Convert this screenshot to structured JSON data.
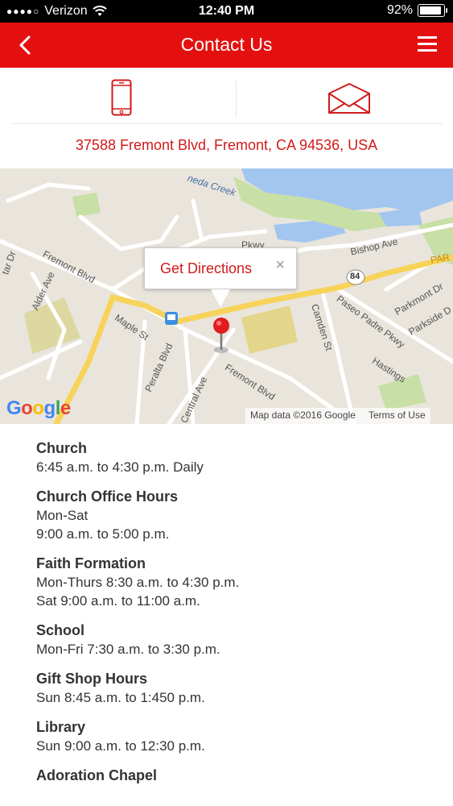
{
  "status_bar": {
    "carrier": "Verizon",
    "time": "12:40 PM",
    "battery": "92%",
    "battery_level": 0.92
  },
  "header": {
    "title": "Contact Us",
    "back_icon": "chevron-left-icon",
    "menu_icon": "hamburger-menu-icon"
  },
  "contact": {
    "phone_icon": "phone-icon",
    "email_icon": "envelope-icon",
    "address": "37588 Fremont Blvd, Fremont, CA 94536, USA"
  },
  "map": {
    "popup_label": "Get Directions",
    "close_glyph": "×",
    "zoom_in": "+",
    "zoom_out": "−",
    "attribution": "Map data ©2016 Google",
    "terms": "Terms of Use",
    "logo": "Google",
    "street_labels": {
      "fremont_blvd_1": "Fremont Blvd",
      "fremont_blvd_2": "Fremont Blvd",
      "maple_st": "Maple St",
      "peralta_blvd": "Peralta Blvd",
      "central_ave": "Central Ave",
      "alder_ave": "Alder Ave",
      "bishop_ave": "Bishop Ave",
      "paseo_padre": "Paseo Padre Pkwy",
      "camden_st": "Camden St",
      "hastings": "Hastings",
      "parkmont_dr": "Parkmont Dr",
      "parkside_dr": "Parkside D",
      "creek": "neda Creek",
      "pkwy": "Pkwy",
      "route": "84",
      "par": "PAR",
      "tar_dr": "tar Dr"
    },
    "colors": {
      "land": "#e9e5dc",
      "water": "#a3c6f0",
      "park": "#c8dfa5",
      "highway": "#f7d35a",
      "road": "#ffffff"
    }
  },
  "hours": [
    {
      "title": "Church",
      "lines": [
        "6:45 a.m. to 4:30 p.m. Daily"
      ]
    },
    {
      "title": "Church Office Hours",
      "lines": [
        "Mon-Sat",
        "9:00 a.m. to 5:00 p.m."
      ]
    },
    {
      "title": "Faith Formation",
      "lines": [
        "Mon-Thurs 8:30 a.m. to 4:30 p.m.",
        "Sat 9:00 a.m. to 11:00 a.m."
      ]
    },
    {
      "title": "School",
      "lines": [
        "Mon-Fri 7:30 a.m. to 3:30 p.m."
      ]
    },
    {
      "title": "Gift Shop Hours",
      "lines": [
        "Sun 8:45 a.m. to 1:450 p.m."
      ]
    },
    {
      "title": "Library",
      "lines": [
        "Sun 9:00 a.m. to 12:30 p.m."
      ]
    },
    {
      "title": "Adoration Chapel",
      "lines": []
    }
  ],
  "brand_color": "#e41010"
}
